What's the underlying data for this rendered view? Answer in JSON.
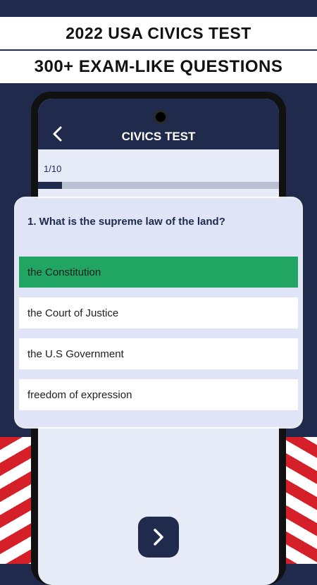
{
  "banner": {
    "line1": "2022 USA CIVICS TEST",
    "line2": "300+ EXAM-LIKE QUESTIONS"
  },
  "app": {
    "title": "CIVICS TEST",
    "progress_label": "1/10",
    "progress_fraction": 0.1
  },
  "quiz": {
    "question": "1. What is the supreme law of the land?",
    "answers": [
      {
        "label": "the Constitution",
        "state": "correct"
      },
      {
        "label": "the Court of Justice",
        "state": "default"
      },
      {
        "label": "the U.S Government",
        "state": "default"
      },
      {
        "label": "freedom of expression",
        "state": "default"
      }
    ]
  },
  "colors": {
    "navy": "#1f2a4d",
    "correct_green": "#21a563",
    "flag_red": "#d5202a",
    "card_bg": "#dfe4f6"
  },
  "icons": {
    "back": "chevron-left-icon",
    "next": "chevron-right-icon"
  }
}
